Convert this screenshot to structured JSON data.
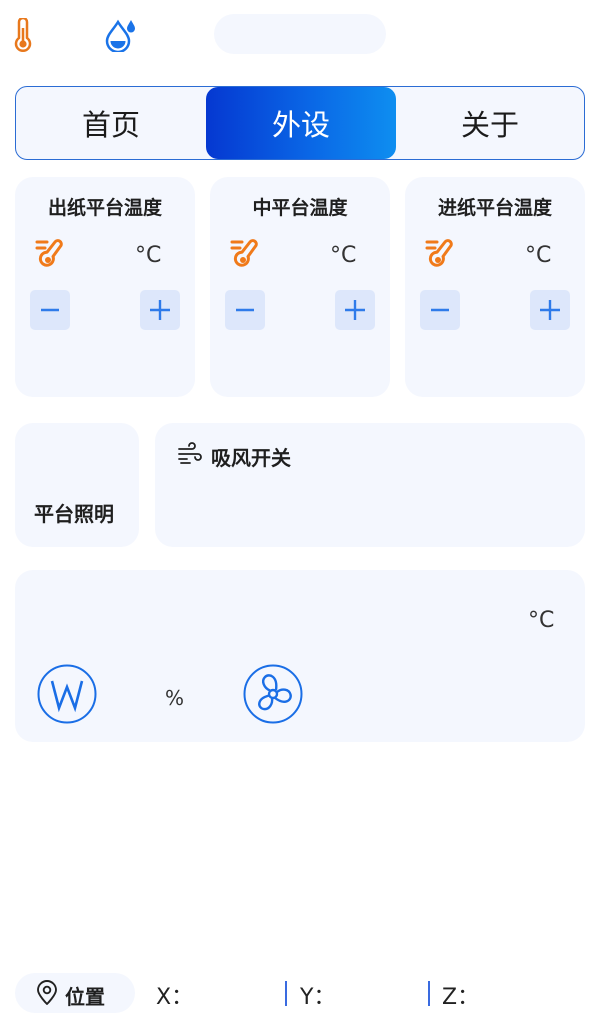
{
  "tabs": [
    {
      "label": "首页",
      "active": false
    },
    {
      "label": "外设",
      "active": true
    },
    {
      "label": "关于",
      "active": false
    }
  ],
  "heaters": [
    {
      "title": "出纸平台温度",
      "unit": "°C"
    },
    {
      "title": "中平台温度",
      "unit": "°C"
    },
    {
      "title": "进纸平台温度",
      "unit": "°C"
    }
  ],
  "lighting": {
    "label": "平台照明"
  },
  "suction": {
    "label": "吸风开关"
  },
  "sensor": {
    "temp_unit": "°C",
    "percent_unit": "%"
  },
  "position": {
    "label": "位置",
    "x_label": "X：",
    "y_label": "Y：",
    "z_label": "Z："
  },
  "icons": {
    "status_temperature": "thermometer-icon",
    "status_humidity": "water-drop-icon",
    "heater": "heating-thermometer-icon",
    "decrease": "minus-icon",
    "increase": "plus-icon",
    "wind": "wind-icon",
    "w_button": "w-letter-icon",
    "fan": "fan-icon",
    "location": "location-pin-icon"
  },
  "colors": {
    "accent": "#0a67e6",
    "tab_active_start": "#0538d1",
    "tab_active_end": "#0e8ef0",
    "card_bg": "#f4f7fe",
    "heat_icon": "#f07a1a",
    "button_bg": "#dde7fb"
  }
}
